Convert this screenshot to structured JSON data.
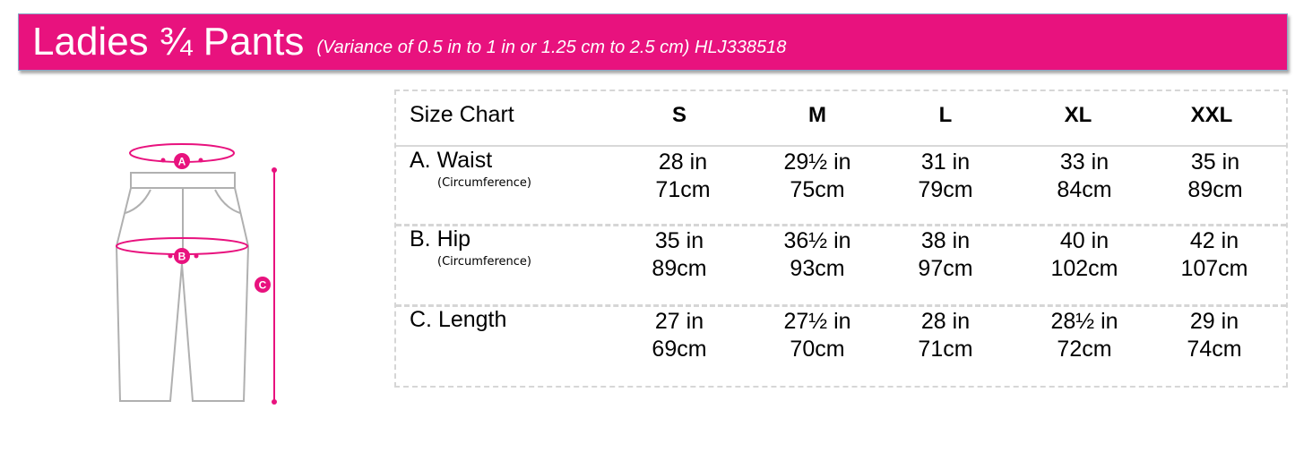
{
  "header": {
    "title": "Ladies ¾ Pants",
    "subtitle": "(Variance of 0.5 in to 1 in or 1.25 cm to 2.5 cm) HLJ338518"
  },
  "diagram": {
    "marker_a": "A",
    "marker_b": "B",
    "marker_c": "C"
  },
  "size_chart": {
    "corner_label": "Size Chart",
    "sizes": [
      "S",
      "M",
      "L",
      "XL",
      "XXL"
    ],
    "rows": [
      {
        "name": "A. Waist",
        "note": "(Circumference)",
        "inches": [
          "28 in",
          "29½ in",
          "31 in",
          "33 in",
          "35 in"
        ],
        "cm": [
          "71cm",
          "75cm",
          "79cm",
          "84cm",
          "89cm"
        ]
      },
      {
        "name": "B. Hip",
        "note": "(Circumference)",
        "inches": [
          "35 in",
          "36½ in",
          "38 in",
          "40 in",
          "42 in"
        ],
        "cm": [
          "89cm",
          "93cm",
          "97cm",
          "102cm",
          "107cm"
        ]
      },
      {
        "name": "C. Length",
        "note": "",
        "inches": [
          "27 in",
          "27½ in",
          "28 in",
          "28½ in",
          "29 in"
        ],
        "cm": [
          "69cm",
          "70cm",
          "71cm",
          "72cm",
          "74cm"
        ]
      }
    ]
  },
  "colors": {
    "accent": "#e8127e",
    "outline": "#b0b0b0"
  }
}
